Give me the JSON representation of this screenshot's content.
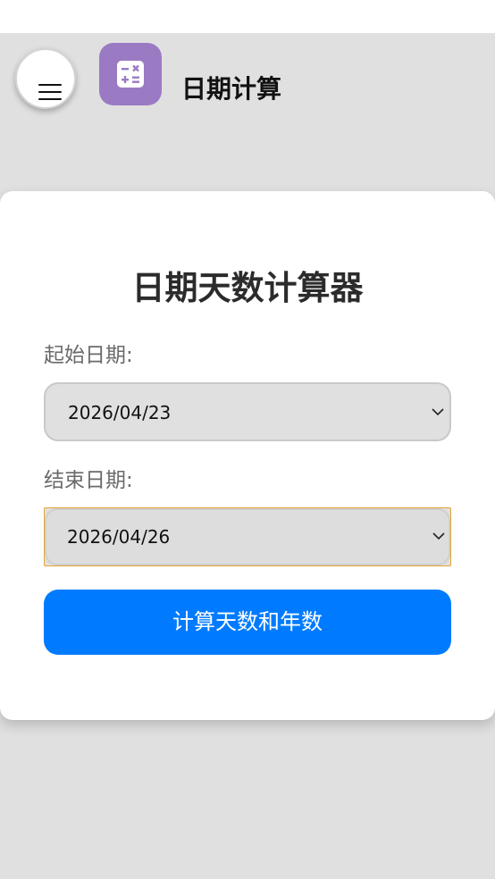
{
  "header": {
    "app_title": "日期计算"
  },
  "icons": {
    "menu": "hamburger-menu-icon",
    "app_logo": "calculator-icon",
    "dropdown": "chevron-down-icon"
  },
  "colors": {
    "background": "#e0e0e0",
    "app_logo": "#9b7ac4",
    "primary_button": "#007bff",
    "focus_outline": "#e3a231"
  },
  "card": {
    "title": "日期天数计算器",
    "start_date": {
      "label": "起始日期:",
      "value": "2026/04/23"
    },
    "end_date": {
      "label": "结束日期:",
      "value": "2026/04/26"
    },
    "calculate_button": "计算天数和年数"
  }
}
